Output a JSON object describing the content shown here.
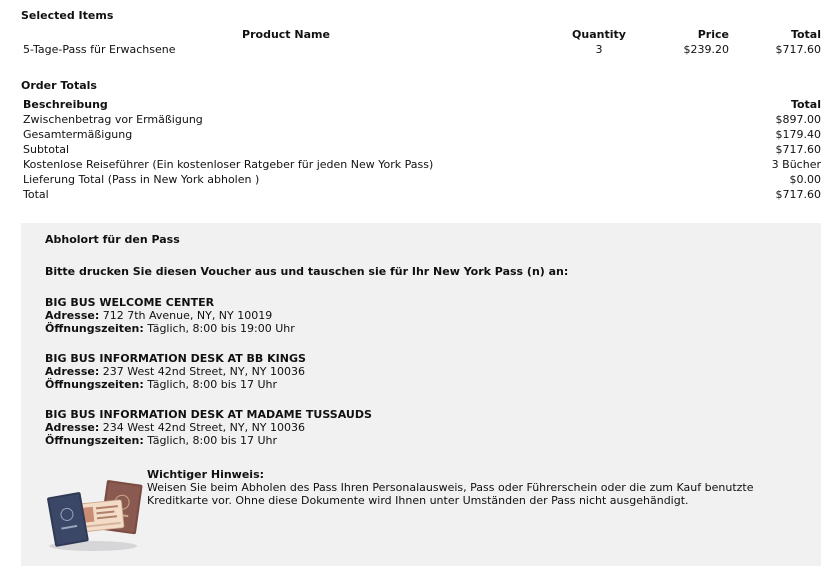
{
  "selected_items": {
    "heading": "Selected Items",
    "columns": {
      "product": "Product Name",
      "quantity": "Quantity",
      "price": "Price",
      "total": "Total"
    },
    "rows": [
      {
        "product": "5-Tage-Pass für Erwachsene",
        "quantity": "3",
        "price": "$239.20",
        "total": "$717.60"
      }
    ]
  },
  "order_totals": {
    "heading": "Order Totals",
    "columns": {
      "description": "Beschreibung",
      "total": "Total"
    },
    "rows": [
      {
        "label": "Zwischenbetrag vor Ermäßigung",
        "value": "$897.00"
      },
      {
        "label": "Gesamtermäßigung",
        "value": "$179.40"
      },
      {
        "label": "Subtotal",
        "value": "$717.60"
      },
      {
        "label": "Kostenlose Reiseführer (Ein kostenloser Ratgeber für jeden New York Pass)",
        "value": "3 Bücher"
      },
      {
        "label": "Lieferung Total (Pass in New York abholen )",
        "value": "$0.00"
      },
      {
        "label": "Total",
        "value": "$717.60"
      }
    ]
  },
  "pickup": {
    "title": "Abholort für den Pass",
    "instructions": "Bitte drucken Sie diesen Voucher aus und tauschen sie für Ihr New York Pass (n) an:",
    "address_label": "Adresse:",
    "hours_label": "Öffnungszeiten:",
    "locations": [
      {
        "name": "BIG BUS WELCOME CENTER",
        "address": "712 7th Avenue, NY, NY 10019",
        "hours": "Täglich, 8:00 bis 19:00 Uhr"
      },
      {
        "name": "BIG BUS INFORMATION DESK AT BB KINGS",
        "address": "237 West 42nd Street, NY, NY 10036",
        "hours": "Täglich, 8:00 bis 17 Uhr"
      },
      {
        "name": "BIG BUS INFORMATION DESK AT MADAME TUSSAUDS",
        "address": "234 West 42nd Street, NY, NY 10036",
        "hours": "Täglich, 8:00 bis 17 Uhr"
      }
    ],
    "notice": {
      "heading": "Wichtiger Hinweis:",
      "body": "Weisen Sie beim Abholen des Pass Ihren Personalausweis, Pass oder Führerschein oder die zum Kauf benutzte Kreditkarte vor. Ohne diese Dokumente wird Ihnen unter Umständen der Pass nicht ausgehändigt.",
      "image_icon": "id-documents-icon"
    }
  }
}
